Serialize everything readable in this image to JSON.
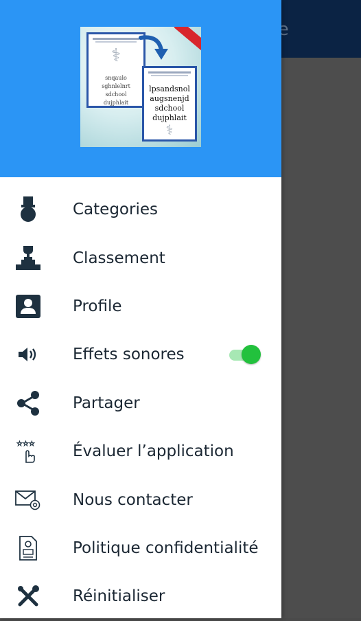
{
  "background_app": {
    "title_fragment": "ce"
  },
  "drawer": {
    "header": {
      "logo": {
        "left_paper_text": [
          "snqaulo",
          "sghnlelnrt",
          "sdchool",
          "dujphlait"
        ],
        "right_paper_text": [
          "lpsandsnol",
          "augsnenjd",
          "sdchool",
          "dujphlait"
        ]
      }
    },
    "menu": [
      {
        "id": "categories",
        "label": "Categories",
        "icon": "medal-icon"
      },
      {
        "id": "classement",
        "label": "Classement",
        "icon": "trophy-podium-icon"
      },
      {
        "id": "profile",
        "label": "Profile",
        "icon": "account-box-icon"
      },
      {
        "id": "effets",
        "label": "Effets sonores",
        "icon": "volume-icon",
        "toggle_on": true
      },
      {
        "id": "partager",
        "label": "Partager",
        "icon": "share-icon"
      },
      {
        "id": "evaluer",
        "label": "Évaluer l’application",
        "icon": "rate-stars-icon"
      },
      {
        "id": "contact",
        "label": "Nous contacter",
        "icon": "mail-icon"
      },
      {
        "id": "politique",
        "label": "Politique confidentialité",
        "icon": "privacy-document-icon"
      },
      {
        "id": "reset",
        "label": "Réinitialiser",
        "icon": "tools-icon"
      }
    ]
  },
  "colors": {
    "drawer_header": "#2b95f5",
    "app_toolbar": "#0b2344",
    "toggle_on": "#22c13d",
    "icon": "#1e3140"
  }
}
